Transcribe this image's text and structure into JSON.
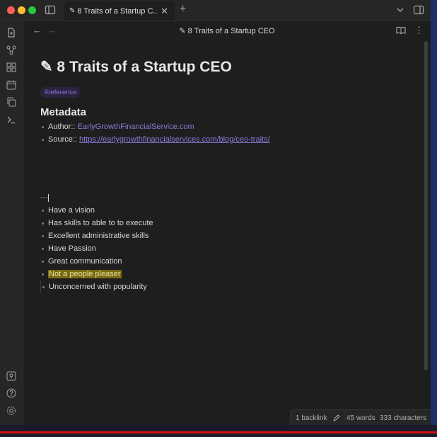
{
  "window": {
    "tab_title": "8 Traits of a Startup C...",
    "tab_icon": "✎",
    "close_glyph": "✕",
    "new_tab_glyph": "+"
  },
  "view_header": {
    "title": "✎ 8 Traits of a Startup CEO",
    "back_glyph": "←",
    "forward_glyph": "→",
    "more_glyph": "⋮"
  },
  "ribbon": {
    "icons": [
      "open-file-icon",
      "graph-icon",
      "canvas-icon",
      "calendar-icon",
      "copy-icon",
      "terminal-icon",
      "vault-icon",
      "help-icon",
      "settings-icon"
    ]
  },
  "note": {
    "title": "✎ 8 Traits of a Startup CEO",
    "tag": "#reference",
    "metadata_heading": "Metadata",
    "author_label": "Author::",
    "author_value": "EarlyGrowthFinancialService.com",
    "source_label": "Source::",
    "source_value": "https://earlygrowthfinancialservices.com/blog/ceo-traits/",
    "hr": "---",
    "traits": [
      "Have a vision",
      "Has skills to able to to execute",
      "Excellent administrative skills",
      "Have Passion",
      "Great communication",
      "Not a people pleaser"
    ],
    "sub_trait": "Unconcerned with popularity"
  },
  "status_bar": {
    "backlinks": "1 backlink",
    "words": "45 words",
    "characters": "333 characters"
  },
  "colors": {
    "accent": "#8a7bd8",
    "highlight": "#7a6a12",
    "background": "#1e1e1e"
  }
}
